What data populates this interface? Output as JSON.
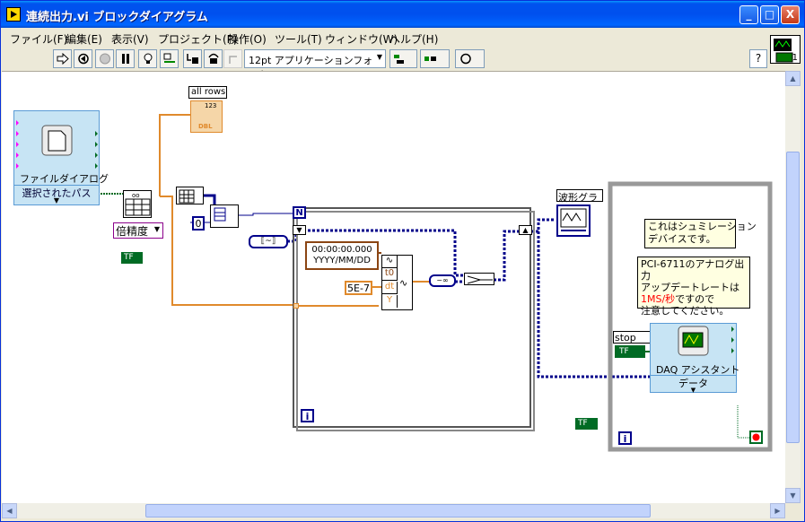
{
  "window": {
    "title": "連続出力.vi ブロックダイアグラム",
    "minimize": "_",
    "maximize": "□",
    "close": "X"
  },
  "menu": [
    "ファイル(F)",
    "編集(E)",
    "表示(V)",
    "プロジェクト(P)",
    "操作(O)",
    "ツール(T)",
    "ウィンドウ(W)",
    "ヘルプ(H)"
  ],
  "toolbar": {
    "font": "12pt アプリケーションフォント",
    "help": "?",
    "connector_count": "1"
  },
  "diagram": {
    "file_dialog": {
      "label": "ファイルダイアログ",
      "output": "選択されたパス"
    },
    "all_rows": "all rows",
    "all_rows_type": "DBL",
    "all_rows_num": "123",
    "double_selector": "倍精度",
    "tf_constant": "TF",
    "zero_const": "0",
    "loop_N": "N",
    "loop_i": "i",
    "timestamp": "00:00:00.000\nYYYY/MM/DD",
    "t0": "t0",
    "dt": "dt",
    "Y": "Y",
    "dt_const": "5E-7",
    "waveform_graph": "波形グラフ",
    "note1": "これはシュミレーション\nデバイスです。",
    "note2_line1": "PCI-6711のアナログ出力",
    "note2_line2": "アップデートレートは",
    "note2_line3a": "1MS/秒",
    "note2_line3b": "ですので",
    "note2_line4": "注意してください。",
    "stop_label": "stop (F)",
    "daq_label": "DAQ アシスタント",
    "daq_data": "データ"
  },
  "colors": {
    "titlebar": "#0054e3",
    "wire_orange": "#e08a2c",
    "wire_blue": "#00008b",
    "wire_green": "#006b24",
    "wire_pink": "#ff00ff",
    "red_text": "#ff0000"
  }
}
